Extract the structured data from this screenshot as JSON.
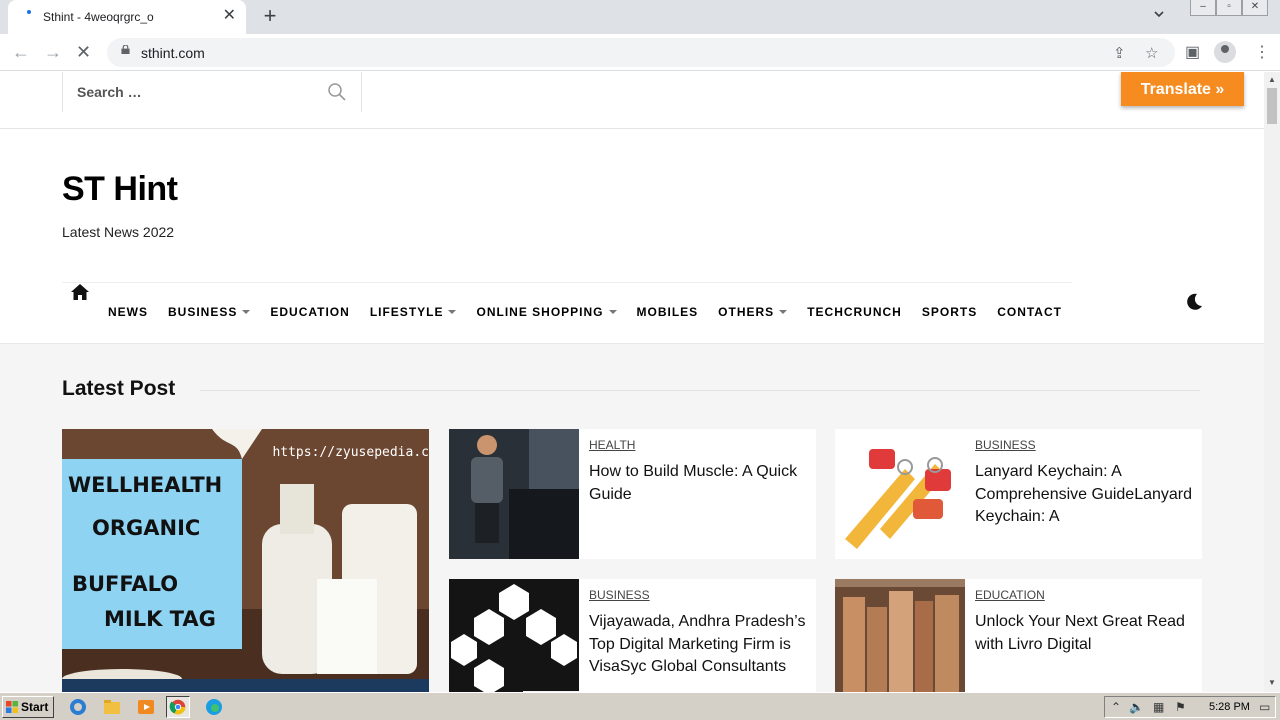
{
  "browser": {
    "tab_title": "Sthint - 4weoqrgrc_o",
    "tab_close": "✕",
    "new_tab": "+",
    "url": "sthint.com"
  },
  "header": {
    "search_placeholder": "Search …",
    "translate_label": "Translate »",
    "site_title": "ST Hint",
    "tagline": "Latest News 2022"
  },
  "menu": [
    {
      "label": "NEWS",
      "dropdown": false
    },
    {
      "label": "BUSINESS",
      "dropdown": true
    },
    {
      "label": "EDUCATION",
      "dropdown": false
    },
    {
      "label": "LIFESTYLE",
      "dropdown": true
    },
    {
      "label": "ONLINE SHOPPING",
      "dropdown": true
    },
    {
      "label": "MOBILES",
      "dropdown": false
    },
    {
      "label": "OTHERS",
      "dropdown": true
    },
    {
      "label": "TECHCRUNCH",
      "dropdown": false
    },
    {
      "label": "SPORTS",
      "dropdown": false
    },
    {
      "label": "CONTACT",
      "dropdown": false
    }
  ],
  "latest": {
    "title": "Latest Post",
    "feature": {
      "url_text": "https://zyusepedia.c",
      "lines": [
        "WELLHEALTH",
        "ORGANIC",
        "BUFFALO",
        "MILK TAG"
      ]
    },
    "cards": [
      {
        "category": "HEALTH",
        "title": "How to Build Muscle: A Quick Guide"
      },
      {
        "category": "BUSINESS",
        "title": "Lanyard Keychain: A Comprehensive GuideLanyard Keychain: A"
      },
      {
        "category": "BUSINESS",
        "title": "Vijayawada, Andhra Pradesh’s Top Digital Marketing Firm is VisaSyc Global Consultants"
      },
      {
        "category": "EDUCATION",
        "title": "Unlock Your Next Great Read with Livro Digital"
      }
    ]
  },
  "taskbar": {
    "start": "Start",
    "clock": "5:28 PM"
  },
  "colors": {
    "translate": "#f68b1f",
    "section_bg": "#f5f5f5"
  }
}
